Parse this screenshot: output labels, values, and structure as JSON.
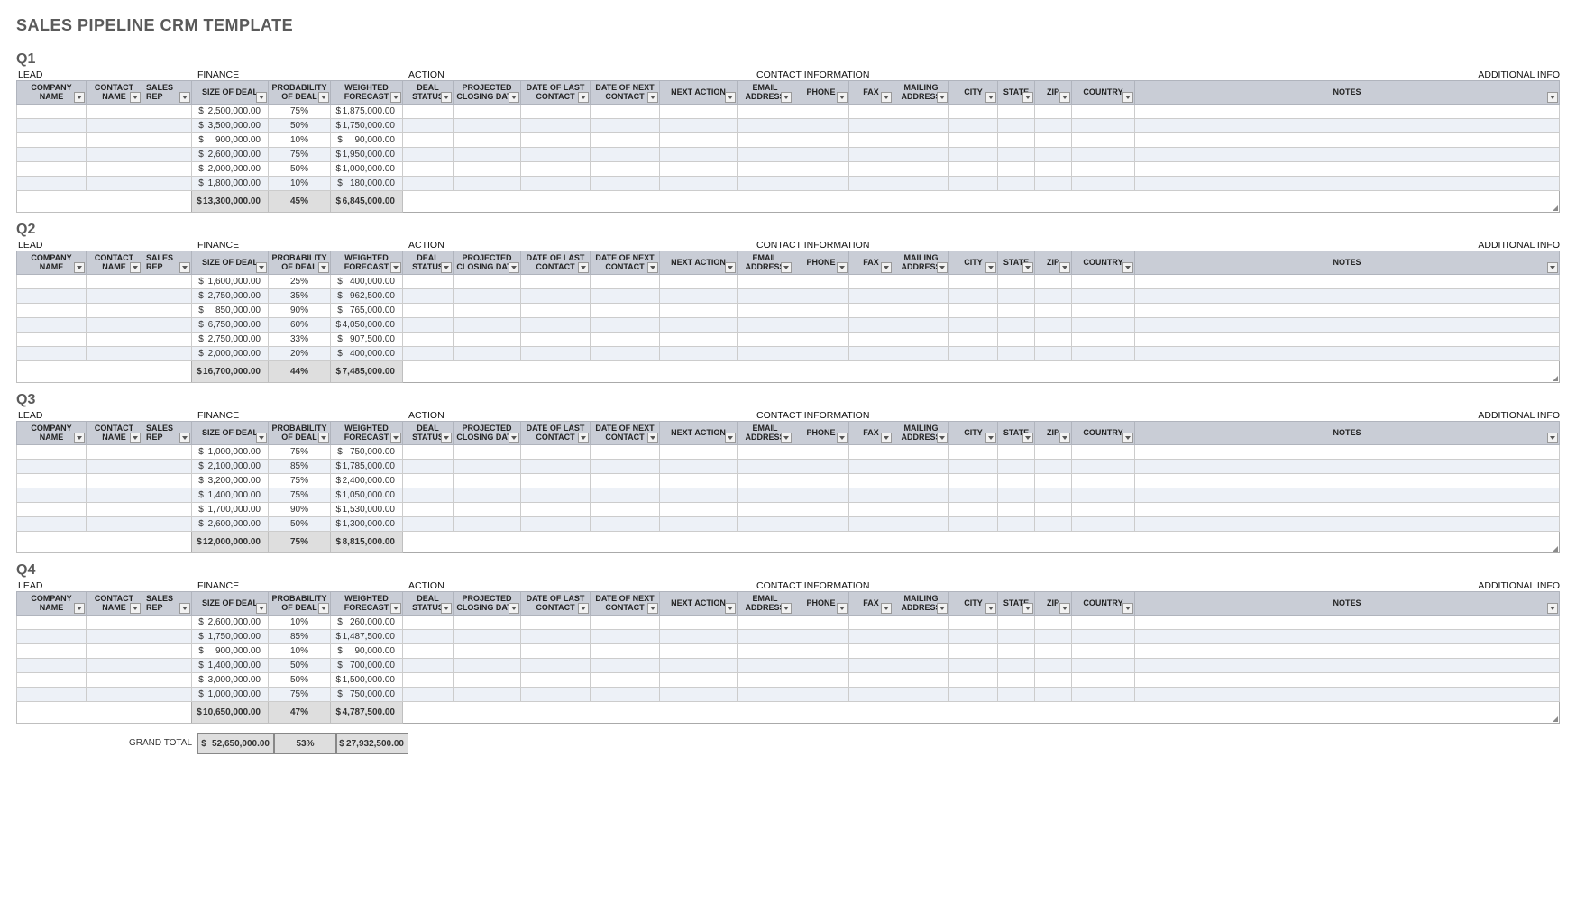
{
  "title": "SALES PIPELINE CRM TEMPLATE",
  "groupLabels": {
    "lead": "LEAD",
    "finance": "FINANCE",
    "action": "ACTION",
    "contact": "CONTACT INFORMATION",
    "additional": "ADDITIONAL INFO"
  },
  "columns": [
    "COMPANY NAME",
    "CONTACT NAME",
    "SALES REP",
    "SIZE OF DEAL",
    "PROBABILITY OF DEAL",
    "WEIGHTED FORECAST",
    "DEAL STATUS",
    "PROJECTED CLOSING DATE",
    "DATE OF LAST CONTACT",
    "DATE OF NEXT CONTACT",
    "NEXT ACTION",
    "EMAIL ADDRESS",
    "PHONE",
    "FAX",
    "MAILING ADDRESS",
    "CITY",
    "STATE",
    "ZIP",
    "COUNTRY",
    "NOTES"
  ],
  "quarters": [
    {
      "name": "Q1",
      "rows": [
        {
          "size": "2,500,000.00",
          "prob": "75%",
          "forecast": "1,875,000.00"
        },
        {
          "size": "3,500,000.00",
          "prob": "50%",
          "forecast": "1,750,000.00"
        },
        {
          "size": "900,000.00",
          "prob": "10%",
          "forecast": "90,000.00"
        },
        {
          "size": "2,600,000.00",
          "prob": "75%",
          "forecast": "1,950,000.00"
        },
        {
          "size": "2,000,000.00",
          "prob": "50%",
          "forecast": "1,000,000.00"
        },
        {
          "size": "1,800,000.00",
          "prob": "10%",
          "forecast": "180,000.00"
        }
      ],
      "total": {
        "size": "13,300,000.00",
        "prob": "45%",
        "forecast": "6,845,000.00"
      }
    },
    {
      "name": "Q2",
      "rows": [
        {
          "size": "1,600,000.00",
          "prob": "25%",
          "forecast": "400,000.00"
        },
        {
          "size": "2,750,000.00",
          "prob": "35%",
          "forecast": "962,500.00"
        },
        {
          "size": "850,000.00",
          "prob": "90%",
          "forecast": "765,000.00"
        },
        {
          "size": "6,750,000.00",
          "prob": "60%",
          "forecast": "4,050,000.00"
        },
        {
          "size": "2,750,000.00",
          "prob": "33%",
          "forecast": "907,500.00"
        },
        {
          "size": "2,000,000.00",
          "prob": "20%",
          "forecast": "400,000.00"
        }
      ],
      "total": {
        "size": "16,700,000.00",
        "prob": "44%",
        "forecast": "7,485,000.00"
      }
    },
    {
      "name": "Q3",
      "rows": [
        {
          "size": "1,000,000.00",
          "prob": "75%",
          "forecast": "750,000.00"
        },
        {
          "size": "2,100,000.00",
          "prob": "85%",
          "forecast": "1,785,000.00"
        },
        {
          "size": "3,200,000.00",
          "prob": "75%",
          "forecast": "2,400,000.00"
        },
        {
          "size": "1,400,000.00",
          "prob": "75%",
          "forecast": "1,050,000.00"
        },
        {
          "size": "1,700,000.00",
          "prob": "90%",
          "forecast": "1,530,000.00"
        },
        {
          "size": "2,600,000.00",
          "prob": "50%",
          "forecast": "1,300,000.00"
        }
      ],
      "total": {
        "size": "12,000,000.00",
        "prob": "75%",
        "forecast": "8,815,000.00"
      }
    },
    {
      "name": "Q4",
      "rows": [
        {
          "size": "2,600,000.00",
          "prob": "10%",
          "forecast": "260,000.00"
        },
        {
          "size": "1,750,000.00",
          "prob": "85%",
          "forecast": "1,487,500.00"
        },
        {
          "size": "900,000.00",
          "prob": "10%",
          "forecast": "90,000.00"
        },
        {
          "size": "1,400,000.00",
          "prob": "50%",
          "forecast": "700,000.00"
        },
        {
          "size": "3,000,000.00",
          "prob": "50%",
          "forecast": "1,500,000.00"
        },
        {
          "size": "1,000,000.00",
          "prob": "75%",
          "forecast": "750,000.00"
        }
      ],
      "total": {
        "size": "10,650,000.00",
        "prob": "47%",
        "forecast": "4,787,500.00"
      }
    }
  ],
  "grand": {
    "label": "GRAND TOTAL",
    "size": "52,650,000.00",
    "prob": "53%",
    "forecast": "27,932,500.00"
  },
  "currency": "$"
}
